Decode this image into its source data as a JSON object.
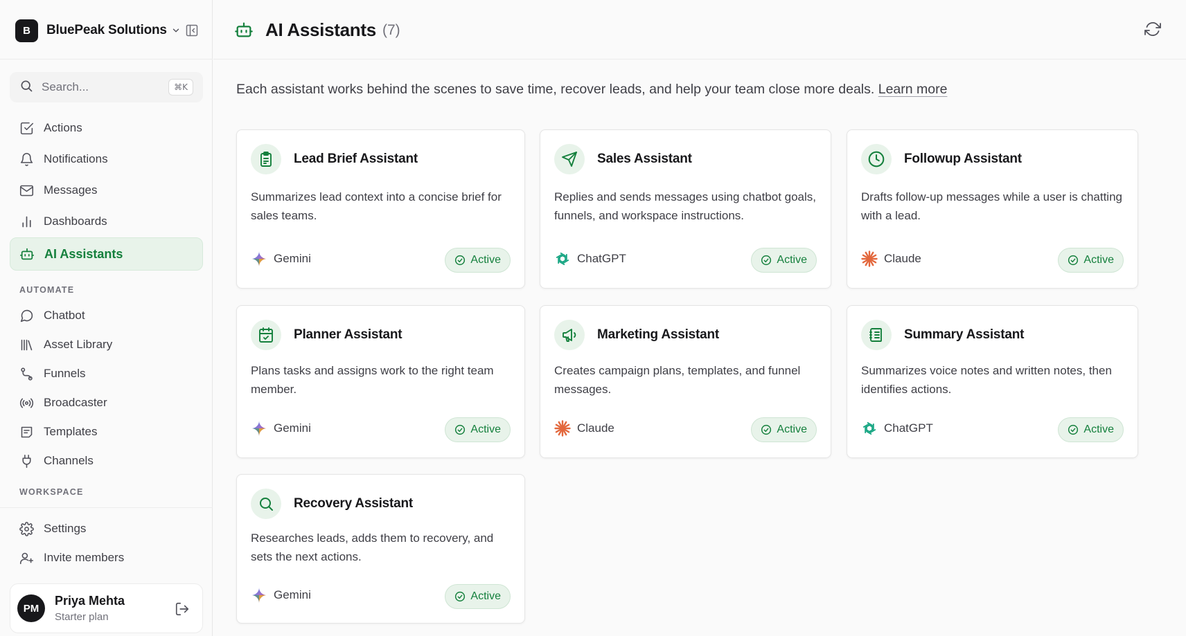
{
  "workspace": {
    "logo_letter": "B",
    "name": "BluePeak Solutions"
  },
  "search": {
    "placeholder": "Search...",
    "shortcut": "⌘K"
  },
  "nav": {
    "primary": [
      {
        "label": "Actions",
        "icon": "check-square-icon"
      },
      {
        "label": "Notifications",
        "icon": "bell-icon"
      },
      {
        "label": "Messages",
        "icon": "mail-icon"
      },
      {
        "label": "Dashboards",
        "icon": "bar-chart-icon"
      },
      {
        "label": "AI Assistants",
        "icon": "bot-icon",
        "active": true
      }
    ],
    "automate_label": "AUTOMATE",
    "automate": [
      {
        "label": "Chatbot",
        "icon": "message-circle-icon"
      },
      {
        "label": "Asset Library",
        "icon": "library-icon"
      },
      {
        "label": "Funnels",
        "icon": "route-icon"
      },
      {
        "label": "Broadcaster",
        "icon": "radio-icon"
      },
      {
        "label": "Templates",
        "icon": "template-icon"
      },
      {
        "label": "Channels",
        "icon": "plug-icon"
      }
    ],
    "workspace_label": "WORKSPACE",
    "workspace": [
      {
        "label": "Settings",
        "icon": "gear-icon"
      },
      {
        "label": "Invite members",
        "icon": "user-plus-icon"
      }
    ]
  },
  "user": {
    "initials": "PM",
    "name": "Priya Mehta",
    "plan": "Starter plan"
  },
  "header": {
    "title": "AI Assistants",
    "count": "(7)"
  },
  "intro": {
    "text": "Each assistant works behind the scenes to save time, recover leads, and help your team close more deals.",
    "link": "Learn more"
  },
  "assistants": [
    {
      "name": "Lead Brief Assistant",
      "description": "Summarizes lead context into a concise brief for sales teams.",
      "model": "Gemini",
      "status": "Active",
      "icon": "clipboard-icon"
    },
    {
      "name": "Sales Assistant",
      "description": "Replies and sends messages using chatbot goals, funnels, and workspace instructions.",
      "model": "ChatGPT",
      "status": "Active",
      "icon": "send-icon"
    },
    {
      "name": "Followup Assistant",
      "description": "Drafts follow-up messages while a user is chatting with a lead.",
      "model": "Claude",
      "status": "Active",
      "icon": "clock-icon"
    },
    {
      "name": "Planner Assistant",
      "description": "Plans tasks and assigns work to the right team member.",
      "model": "Gemini",
      "status": "Active",
      "icon": "calendar-check-icon"
    },
    {
      "name": "Marketing Assistant",
      "description": "Creates campaign plans, templates, and funnel messages.",
      "model": "Claude",
      "status": "Active",
      "icon": "megaphone-icon"
    },
    {
      "name": "Summary Assistant",
      "description": "Summarizes voice notes and written notes, then identifies actions.",
      "model": "ChatGPT",
      "status": "Active",
      "icon": "notes-icon"
    },
    {
      "name": "Recovery Assistant",
      "description": "Researches leads, adds them to recovery, and sets the next actions.",
      "model": "Gemini",
      "status": "Active",
      "icon": "search-icon"
    }
  ],
  "colors": {
    "accent": "#15803d",
    "accent_bg": "#e8f3ea",
    "claude": "#e3683d"
  }
}
